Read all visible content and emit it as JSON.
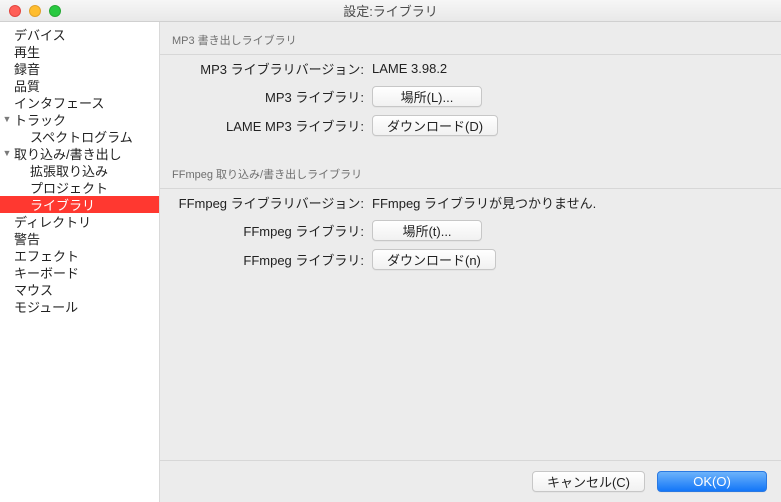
{
  "window": {
    "title": "設定:ライブラリ"
  },
  "sidebar": {
    "items": [
      {
        "label": "デバイス",
        "level": 0,
        "selected": false
      },
      {
        "label": "再生",
        "level": 0,
        "selected": false
      },
      {
        "label": "録音",
        "level": 0,
        "selected": false
      },
      {
        "label": "品質",
        "level": 0,
        "selected": false
      },
      {
        "label": "インタフェース",
        "level": 0,
        "selected": false
      },
      {
        "label": "トラック",
        "level": 0,
        "selected": false,
        "expanded": true
      },
      {
        "label": "スペクトログラム",
        "level": 1,
        "selected": false
      },
      {
        "label": "取り込み/書き出し",
        "level": 0,
        "selected": false,
        "expanded": true
      },
      {
        "label": "拡張取り込み",
        "level": 1,
        "selected": false
      },
      {
        "label": "プロジェクト",
        "level": 1,
        "selected": false
      },
      {
        "label": "ライブラリ",
        "level": 1,
        "selected": true
      },
      {
        "label": "ディレクトリ",
        "level": 0,
        "selected": false
      },
      {
        "label": "警告",
        "level": 0,
        "selected": false
      },
      {
        "label": "エフェクト",
        "level": 0,
        "selected": false
      },
      {
        "label": "キーボード",
        "level": 0,
        "selected": false
      },
      {
        "label": "マウス",
        "level": 0,
        "selected": false
      },
      {
        "label": "モジュール",
        "level": 0,
        "selected": false
      }
    ]
  },
  "mp3": {
    "group_title": "MP3 書き出しライブラリ",
    "version_label": "MP3 ライブラリバージョン:",
    "version_value": "LAME 3.98.2",
    "lib_label": "MP3 ライブラリ:",
    "lib_button": "場所(L)...",
    "lame_label": "LAME MP3 ライブラリ:",
    "lame_button": "ダウンロード(D)"
  },
  "ffmpeg": {
    "group_title": "FFmpeg 取り込み/書き出しライブラリ",
    "version_label": "FFmpeg ライブラリバージョン:",
    "version_value": "FFmpeg ライブラリが見つかりません.",
    "lib_label": "FFmpeg ライブラリ:",
    "lib_button": "場所(t)...",
    "dl_label": "FFmpeg ライブラリ:",
    "dl_button": "ダウンロード(n)"
  },
  "footer": {
    "cancel": "キャンセル(C)",
    "ok": "OK(O)"
  }
}
